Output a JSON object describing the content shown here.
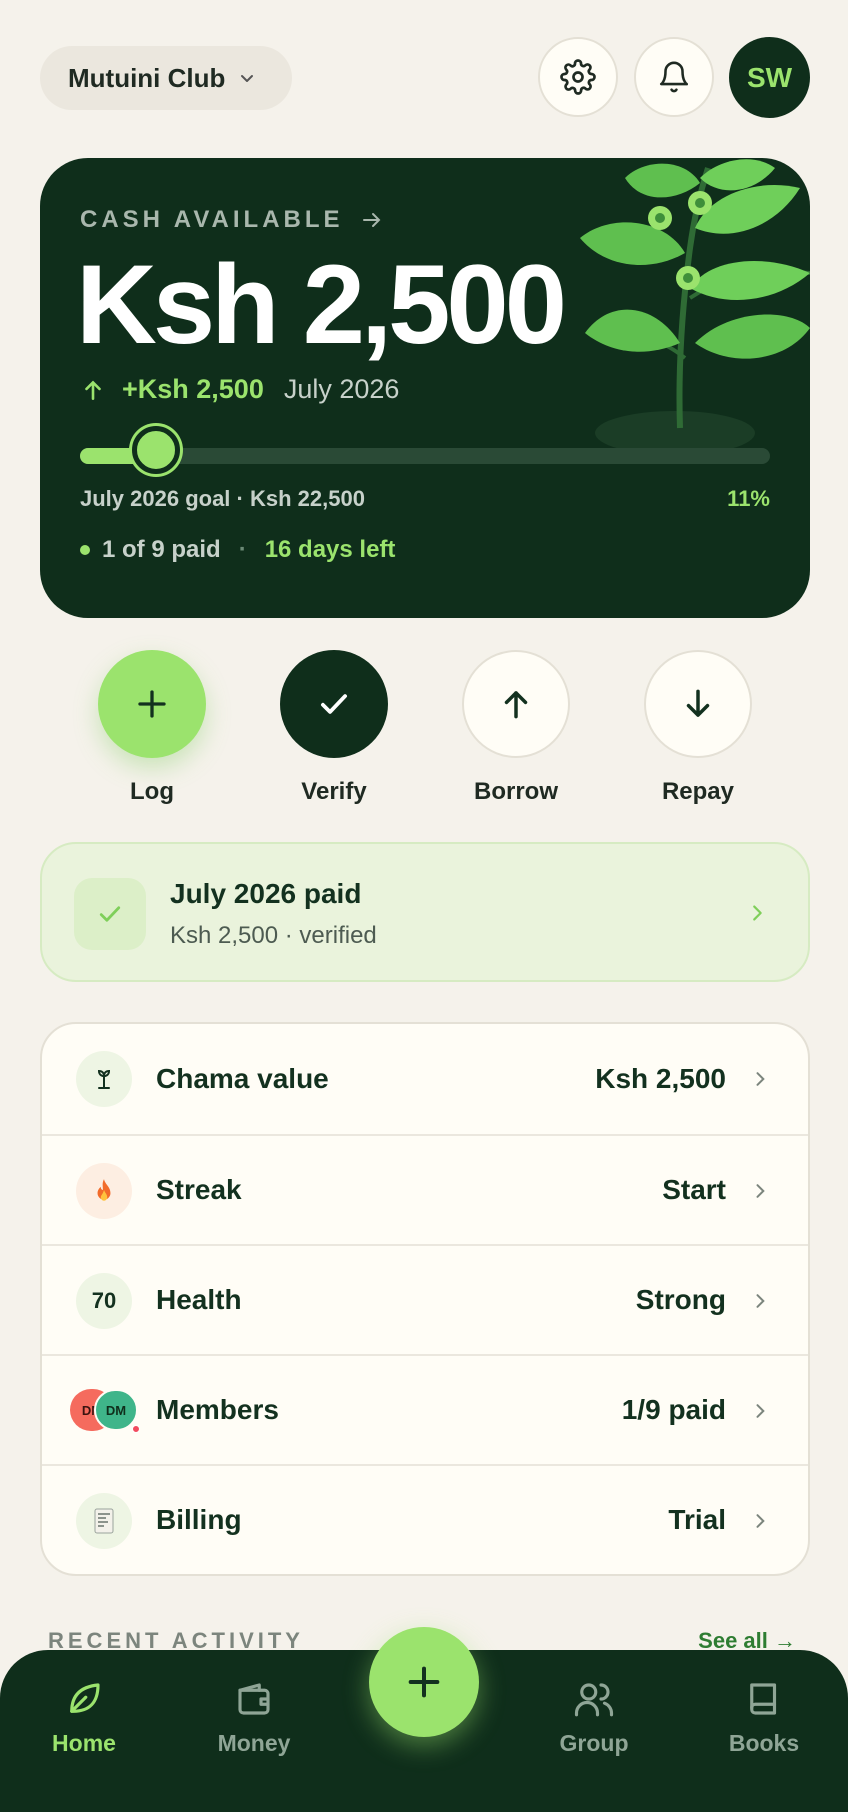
{
  "header": {
    "club_name": "Mutuini Club",
    "avatar_initials": "SW"
  },
  "hero": {
    "label": "CASH AVAILABLE",
    "amount": "Ksh 2,500",
    "delta": "+Ksh 2,500",
    "month": "July 2026",
    "goal_text": "July 2026 goal · Ksh 22,500",
    "progress_percent_text": "11%",
    "progress_fraction": 0.11,
    "paid_count_text": "1 of 9 paid",
    "separator": "·",
    "days_left_text": "16 days left"
  },
  "actions": [
    {
      "label": "Log",
      "icon": "plus-icon"
    },
    {
      "label": "Verify",
      "icon": "check-icon"
    },
    {
      "label": "Borrow",
      "icon": "arrow-up-icon"
    },
    {
      "label": "Repay",
      "icon": "arrow-down-icon"
    }
  ],
  "paid_banner": {
    "title": "July 2026 paid",
    "subtitle": "Ksh 2,500 · verified"
  },
  "summary_rows": [
    {
      "label": "Chama value",
      "value": "Ksh 2,500",
      "icon": "plant-icon"
    },
    {
      "label": "Streak",
      "value": "Start",
      "icon": "fire-icon"
    },
    {
      "label": "Health",
      "value": "Strong",
      "badge": "70"
    },
    {
      "label": "Members",
      "value": "1/9 paid",
      "avatars": [
        "DM",
        "DM"
      ]
    },
    {
      "label": "Billing",
      "value": "Trial",
      "icon": "receipt-icon"
    }
  ],
  "recent": {
    "heading": "RECENT ACTIVITY",
    "see_all": "See all →"
  },
  "nav": [
    {
      "label": "Home",
      "icon": "leaf-icon",
      "active": true
    },
    {
      "label": "Money",
      "icon": "wallet-icon",
      "active": false
    },
    {
      "label": "Group",
      "icon": "users-icon",
      "active": false
    },
    {
      "label": "Books",
      "icon": "book-icon",
      "active": false
    }
  ],
  "colors": {
    "brand_dark": "#0f2e1b",
    "accent_green": "#9be36d",
    "background": "#f5f2eb"
  }
}
